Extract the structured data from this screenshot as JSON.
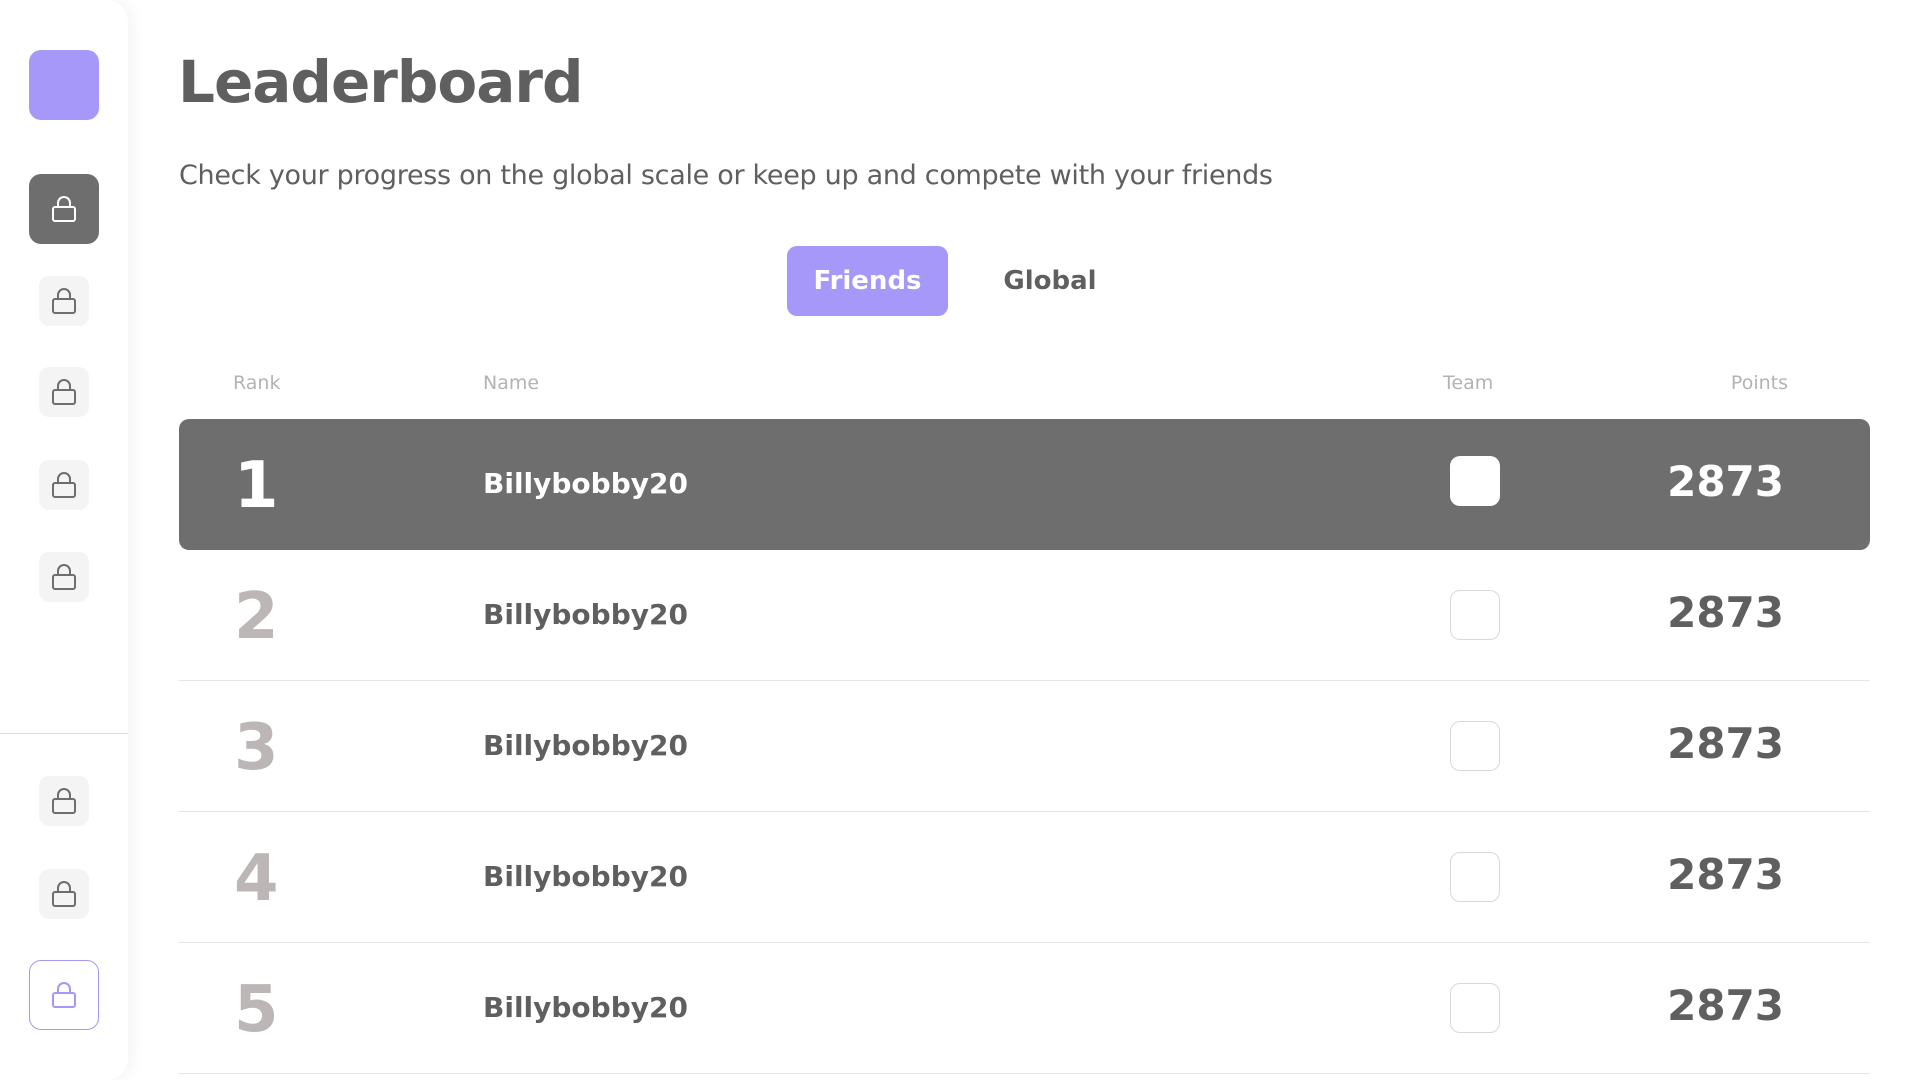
{
  "sidebar": {
    "items": [
      {
        "icon": "lock-icon",
        "state": "active"
      },
      {
        "icon": "lock-icon",
        "state": "default"
      },
      {
        "icon": "lock-icon",
        "state": "default"
      },
      {
        "icon": "lock-icon",
        "state": "default"
      },
      {
        "icon": "lock-icon",
        "state": "default"
      },
      {
        "icon": "lock-icon",
        "state": "default"
      },
      {
        "icon": "lock-icon",
        "state": "default"
      },
      {
        "icon": "lock-icon",
        "state": "outlined"
      }
    ]
  },
  "page": {
    "title": "Leaderboard",
    "subtitle": "Check your progress on the global scale or keep up and compete with your friends"
  },
  "tabs": [
    {
      "label": "Friends",
      "active": true
    },
    {
      "label": "Global",
      "active": false
    }
  ],
  "table": {
    "headers": {
      "rank": "Rank",
      "name": "Name",
      "team": "Team",
      "points": "Points"
    },
    "rows": [
      {
        "rank": "1",
        "name": "Billybobby20",
        "points": "2873"
      },
      {
        "rank": "2",
        "name": "Billybobby20",
        "points": "2873"
      },
      {
        "rank": "3",
        "name": "Billybobby20",
        "points": "2873"
      },
      {
        "rank": "4",
        "name": "Billybobby20",
        "points": "2873"
      },
      {
        "rank": "5",
        "name": "Billybobby20",
        "points": "2873"
      }
    ]
  },
  "colors": {
    "accent": "#a598f8",
    "text": "#5f5f5f",
    "highlight_row": "#6e6e6e",
    "muted": "#b3b3b3"
  }
}
